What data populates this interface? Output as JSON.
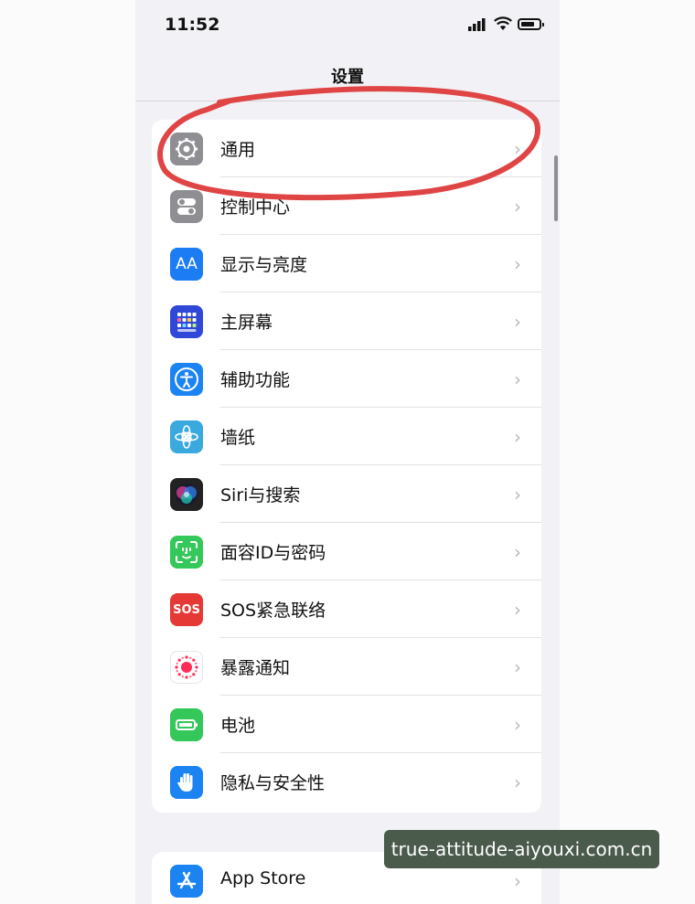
{
  "status_bar": {
    "time": "11:52"
  },
  "nav": {
    "title": "设置"
  },
  "groups": [
    {
      "items": [
        {
          "label": "通用",
          "icon": "gear-icon",
          "color": "#8e8e93"
        },
        {
          "label": "控制中心",
          "icon": "toggles-icon",
          "color": "#8e8e93"
        },
        {
          "label": "显示与亮度",
          "icon": "display-icon",
          "color": "#1c7cf4"
        },
        {
          "label": "主屏幕",
          "icon": "home-grid-icon",
          "color": "#3048d8"
        },
        {
          "label": "辅助功能",
          "icon": "accessibility-icon",
          "color": "#1b84f2"
        },
        {
          "label": "墙纸",
          "icon": "flower-icon",
          "color": "#39a9de"
        },
        {
          "label": "Siri与搜索",
          "icon": "siri-icon",
          "color": "#222222"
        },
        {
          "label": "面容ID与密码",
          "icon": "faceid-icon",
          "color": "#34c759"
        },
        {
          "label": "SOS紧急联络",
          "icon": "sos-icon",
          "color": "#e53935"
        },
        {
          "label": "暴露通知",
          "icon": "exposure-icon",
          "color": "#ffffff"
        },
        {
          "label": "电池",
          "icon": "battery-icon",
          "color": "#34c759"
        },
        {
          "label": "隐私与安全性",
          "icon": "hand-icon",
          "color": "#1b84f2"
        }
      ]
    },
    {
      "items": [
        {
          "label": "App Store",
          "icon": "appstore-icon",
          "color": "#1b84f2"
        }
      ]
    }
  ],
  "icon_glyphs": {
    "display": "AA",
    "sos": "SOS"
  },
  "annotation_color": "#e04545",
  "watermark": "true-attitude-aiyouxi.com.cn"
}
